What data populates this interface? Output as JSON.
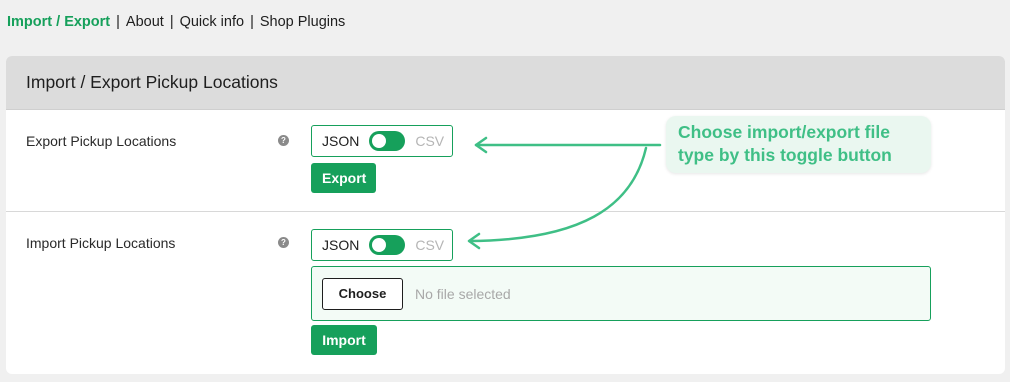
{
  "nav": {
    "items": [
      {
        "label": "Import / Export",
        "active": true
      },
      {
        "label": "About",
        "active": false
      },
      {
        "label": "Quick info",
        "active": false
      },
      {
        "label": "Shop Plugins",
        "active": false
      }
    ],
    "separator": "|"
  },
  "card": {
    "title": "Import / Export Pickup Locations"
  },
  "export": {
    "label": "Export Pickup Locations",
    "help_icon": "question-icon",
    "toggle": {
      "option_on": "JSON",
      "option_off": "CSV"
    },
    "button_label": "Export"
  },
  "import": {
    "label": "Import Pickup Locations",
    "help_icon": "question-icon",
    "toggle": {
      "option_on": "JSON",
      "option_off": "CSV"
    },
    "choose_label": "Choose",
    "file_status": "No file selected",
    "button_label": "Import"
  },
  "annotation": {
    "line1": "Choose import/export file",
    "line2": "type by this toggle button"
  },
  "colors": {
    "accent": "#16a05b",
    "annotation": "#3fbf86"
  }
}
